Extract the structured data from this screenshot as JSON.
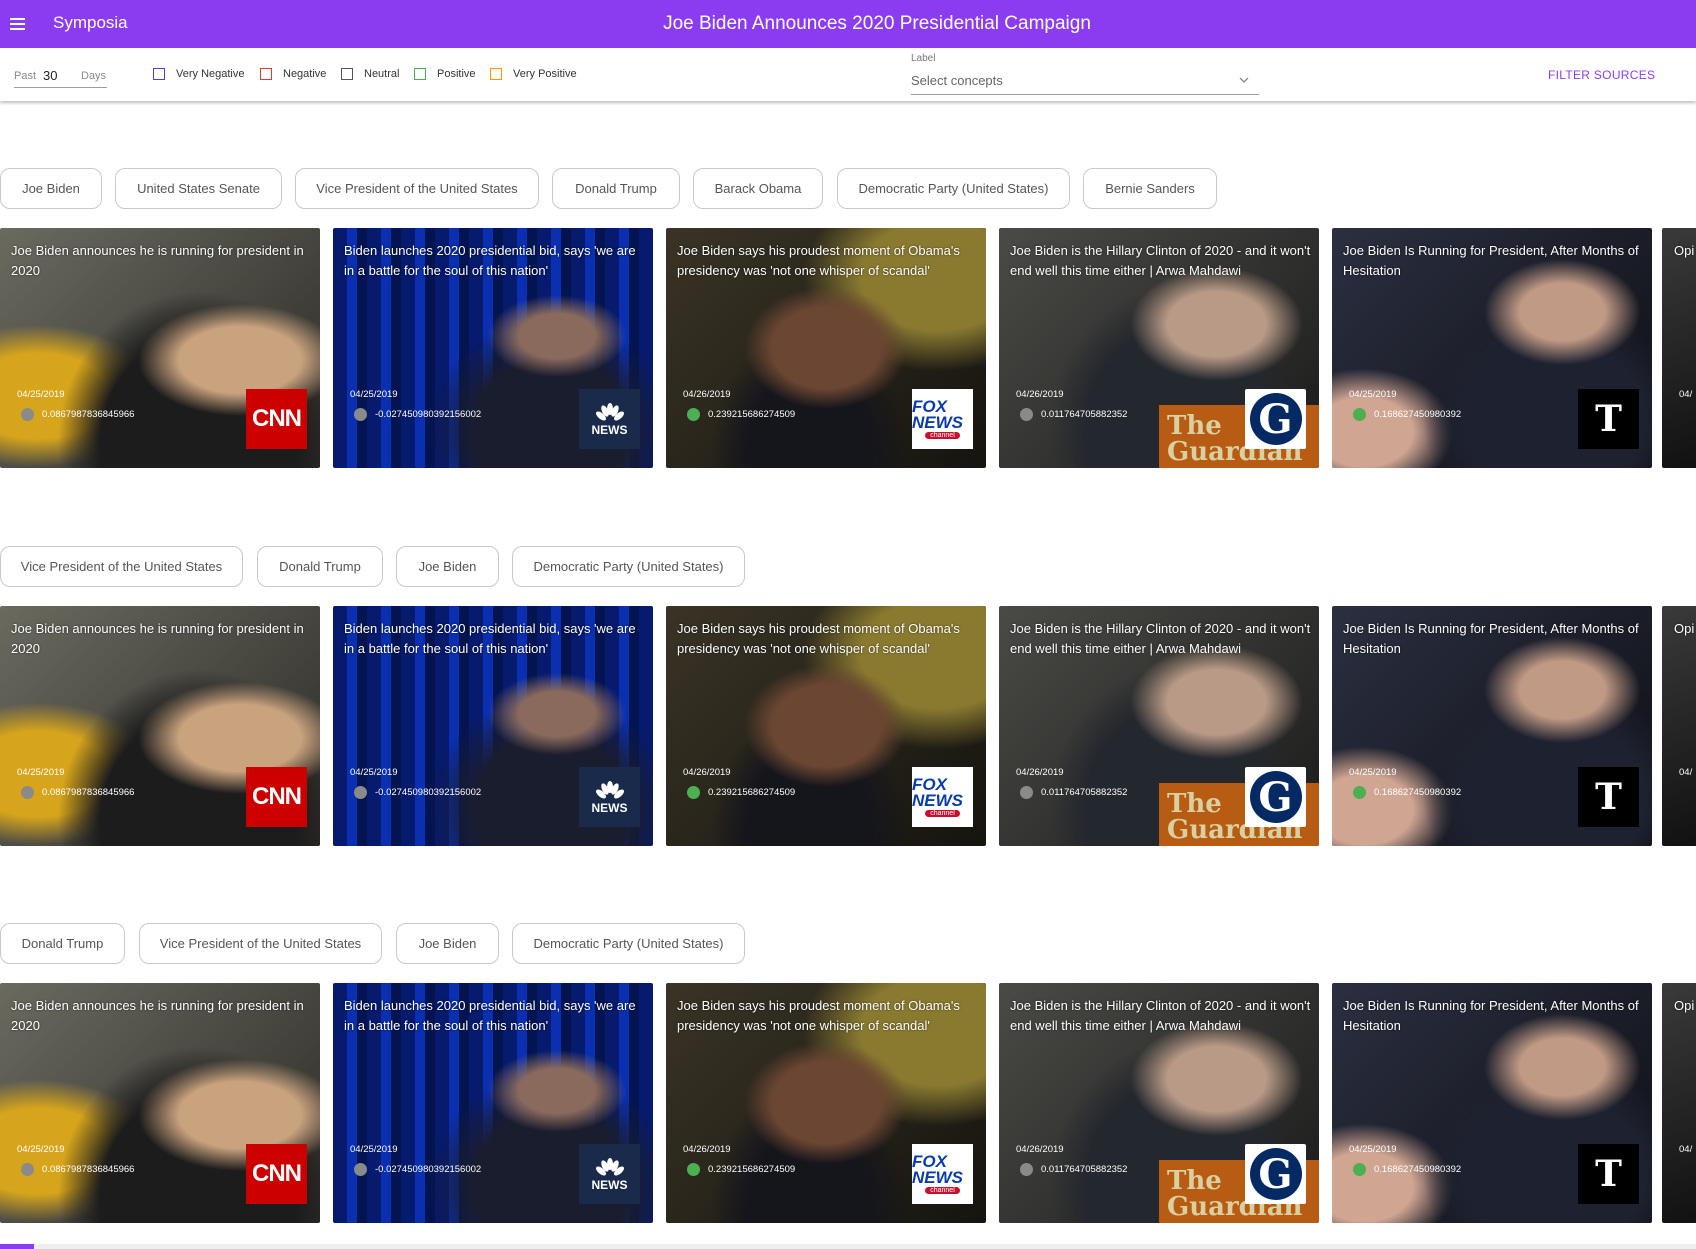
{
  "app": {
    "brand": "Symposia",
    "title": "Joe Biden Announces 2020 Presidential Campaign",
    "accent_color": "#8c3cf0"
  },
  "toolbar": {
    "past_label": "Past",
    "past_value": "30",
    "days_label": "Days",
    "sentiments": [
      {
        "label": "Very Negative",
        "color": "#5b3cc4"
      },
      {
        "label": "Negative",
        "color": "#e53935"
      },
      {
        "label": "Neutral",
        "color": "#555555"
      },
      {
        "label": "Positive",
        "color": "#4caf50"
      },
      {
        "label": "Very Positive",
        "color": "#ff9800"
      }
    ],
    "label_field": {
      "label": "Label",
      "placeholder": "Select concepts"
    },
    "filter_sources": "FILTER SOURCES"
  },
  "articles": [
    {
      "headline": "Joe Biden announces he is running for president in 2020",
      "date": "04/25/2019",
      "score": "0.0867987836845966",
      "sentiment": "neutral",
      "source": "CNN",
      "source_icon": "cnn-logo"
    },
    {
      "headline": "Biden launches 2020 presidential bid, says 'we are in a battle for the soul of this nation'",
      "date": "04/25/2019",
      "score": "-0.027450980392156002",
      "sentiment": "neutral",
      "source": "NEWS",
      "source_icon": "nbc-news-logo"
    },
    {
      "headline": "Joe Biden says his proudest moment of Obama's presidency was 'not one whisper of scandal'",
      "date": "04/26/2019",
      "score": "0.239215686274509",
      "sentiment": "positive",
      "source": "FOX NEWS",
      "source_icon": "fox-news-logo"
    },
    {
      "headline": "Joe Biden is the Hillary Clinton of 2020 - and it won't end well this time either | Arwa Mahdawi",
      "date": "04/26/2019",
      "score": "0.011764705882352",
      "sentiment": "neutral",
      "source": "G",
      "source_icon": "guardian-logo"
    },
    {
      "headline": "Joe Biden Is Running for President, After Months of Hesitation",
      "date": "04/25/2019",
      "score": "0.168627450980392",
      "sentiment": "positive",
      "source": "T",
      "source_icon": "nyt-logo"
    }
  ],
  "partial_card": {
    "headline": "Opi",
    "date": "04/"
  },
  "sections": [
    {
      "chips": [
        "Joe Biden",
        "United States Senate",
        "Vice President of the United States",
        "Donald Trump",
        "Barack Obama",
        "Democratic Party (United States)",
        "Bernie Sanders"
      ]
    },
    {
      "chips": [
        "Vice President of the United States",
        "Donald Trump",
        "Joe Biden",
        "Democratic Party (United States)"
      ]
    },
    {
      "chips": [
        "Donald Trump",
        "Vice President of the United States",
        "Joe Biden",
        "Democratic Party (United States)"
      ]
    }
  ],
  "guardian_banner": "The Guardian"
}
